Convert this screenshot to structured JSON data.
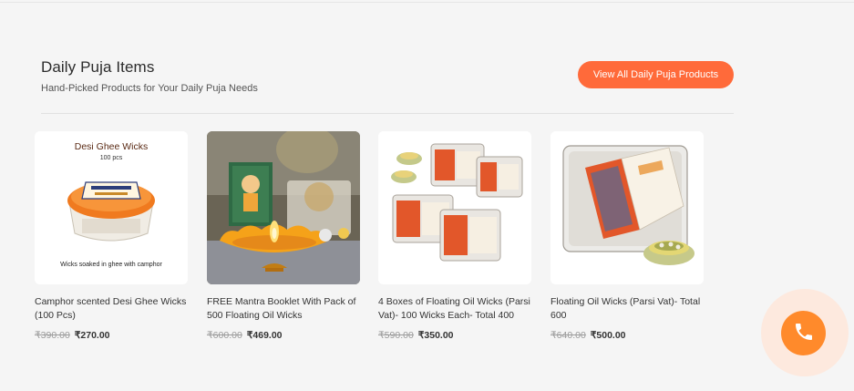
{
  "section": {
    "title": "Daily Puja Items",
    "subtitle": "Hand-Picked Products for Your Daily Puja Needs",
    "view_all_label": "View All Daily Puja Products"
  },
  "products": [
    {
      "name": "Camphor scented Desi Ghee Wicks (100 Pcs)",
      "old_price": "₹390.00",
      "price": "₹270.00",
      "image_texts": {
        "title": "Desi Ghee Wicks",
        "count": "100 pcs",
        "caption": "Wicks soaked in ghee with camphor"
      }
    },
    {
      "name": "FREE Mantra Booklet With Pack of 500 Floating Oil Wicks",
      "old_price": "₹600.00",
      "price": "₹469.00"
    },
    {
      "name": "4 Boxes of Floating Oil Wicks (Parsi Vat)- 100 Wicks Each- Total 400",
      "old_price": "₹590.00",
      "price": "₹350.00"
    },
    {
      "name": "Floating Oil Wicks (Parsi Vat)- Total 600",
      "old_price": "₹640.00",
      "price": "₹500.00"
    }
  ],
  "call_button": {
    "icon": "phone-icon"
  },
  "colors": {
    "accent": "#ff6a3a",
    "call": "#ff8a2b",
    "call_halo": "#fde9de",
    "background": "#f5f5f5"
  }
}
